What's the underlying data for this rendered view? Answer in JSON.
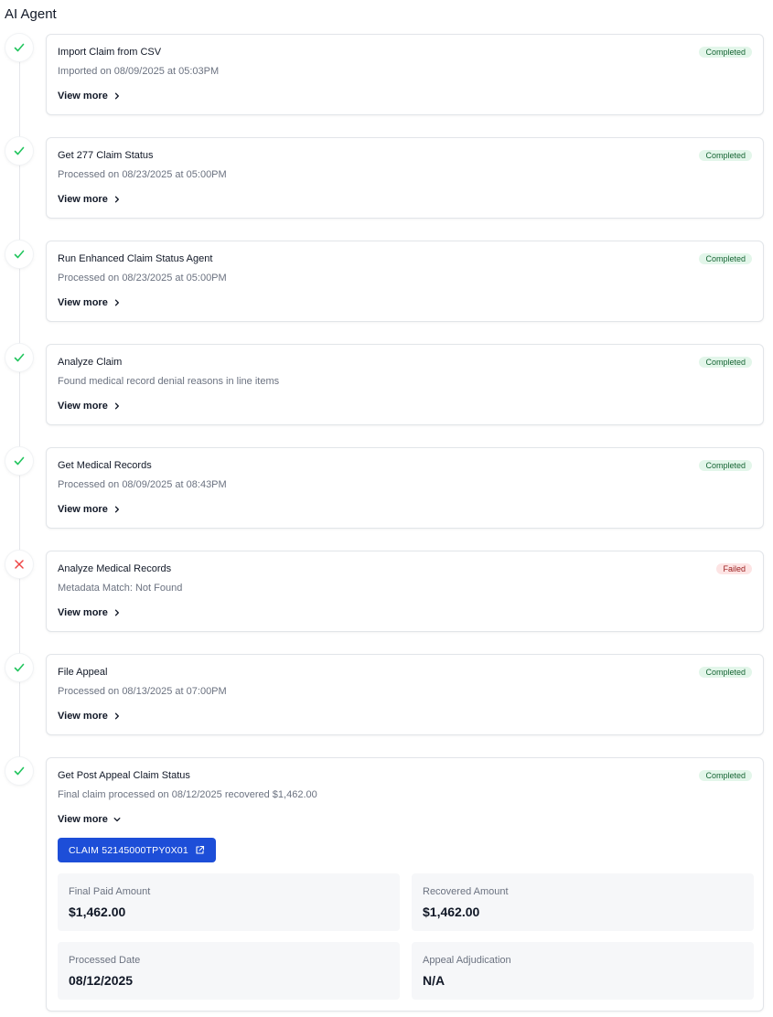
{
  "header": {
    "title": "AI Agent"
  },
  "steps": [
    {
      "title": "Import Claim from CSV",
      "subtitle": "Imported on 08/09/2025 at 05:03PM",
      "status": "Completed",
      "view_more": "View more",
      "icon": "check-icon"
    },
    {
      "title": "Get 277 Claim Status",
      "subtitle": "Processed on 08/23/2025 at 05:00PM",
      "status": "Completed",
      "view_more": "View more",
      "icon": "check-icon"
    },
    {
      "title": "Run Enhanced Claim Status Agent",
      "subtitle": "Processed on 08/23/2025 at 05:00PM",
      "status": "Completed",
      "view_more": "View more",
      "icon": "check-icon"
    },
    {
      "title": "Analyze Claim",
      "subtitle": "Found medical record denial reasons in line items",
      "status": "Completed",
      "view_more": "View more",
      "icon": "check-icon"
    },
    {
      "title": "Get Medical Records",
      "subtitle": "Processed on 08/09/2025 at 08:43PM",
      "status": "Completed",
      "view_more": "View more",
      "icon": "check-icon"
    },
    {
      "title": "Analyze Medical Records",
      "subtitle": "Metadata Match: Not Found",
      "status": "Failed",
      "view_more": "View more",
      "icon": "x-icon"
    },
    {
      "title": "File Appeal",
      "subtitle": "Processed on 08/13/2025 at 07:00PM",
      "status": "Completed",
      "view_more": "View more",
      "icon": "check-icon"
    },
    {
      "title": "Get Post Appeal Claim Status",
      "subtitle": "Final claim processed on 08/12/2025 recovered $1,462.00",
      "status": "Completed",
      "view_more": "View more",
      "icon": "check-icon"
    }
  ],
  "expanded": {
    "claim_button": "CLAIM 52145000TPY0X01",
    "metrics": [
      {
        "label": "Final Paid Amount",
        "value": "$1,462.00"
      },
      {
        "label": "Recovered Amount",
        "value": "$1,462.00"
      },
      {
        "label": "Processed Date",
        "value": "08/12/2025"
      },
      {
        "label": "Appeal Adjudication",
        "value": "N/A"
      }
    ]
  },
  "colors": {
    "success": "#22c55e",
    "error": "#ef4444",
    "accent": "#1d4ed8"
  }
}
